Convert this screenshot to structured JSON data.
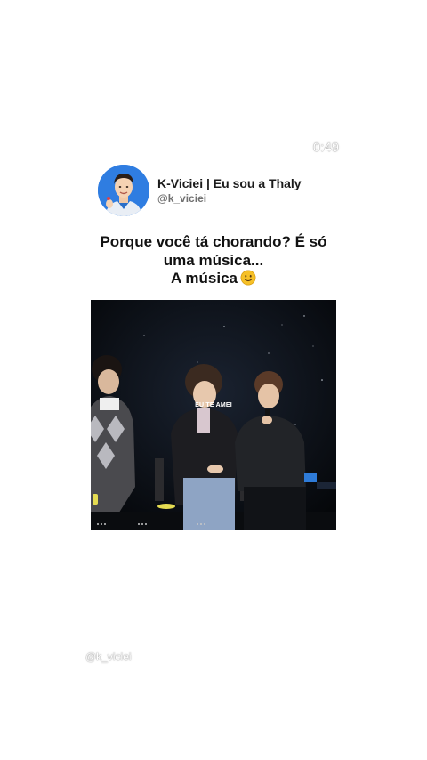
{
  "video": {
    "timestamp": "0:49",
    "subtitle": "EU TE AMEI"
  },
  "post": {
    "display_name": "K-Viciei | Eu sou a Thaly",
    "handle": "@k_viciei",
    "text_line1": "Porque você tá chorando? É só",
    "text_line2": "uma música...",
    "text_line3": "A música",
    "emoji": "slightly-smiling-face-emoji"
  },
  "watermark": "@k_viciei",
  "colors": {
    "background": "#ffffff",
    "avatar_bg": "#2f7de1",
    "text_primary": "#111111",
    "text_secondary": "#6f6f6f",
    "video_bg": "#07090c",
    "emoji_yellow": "#f6c026"
  }
}
